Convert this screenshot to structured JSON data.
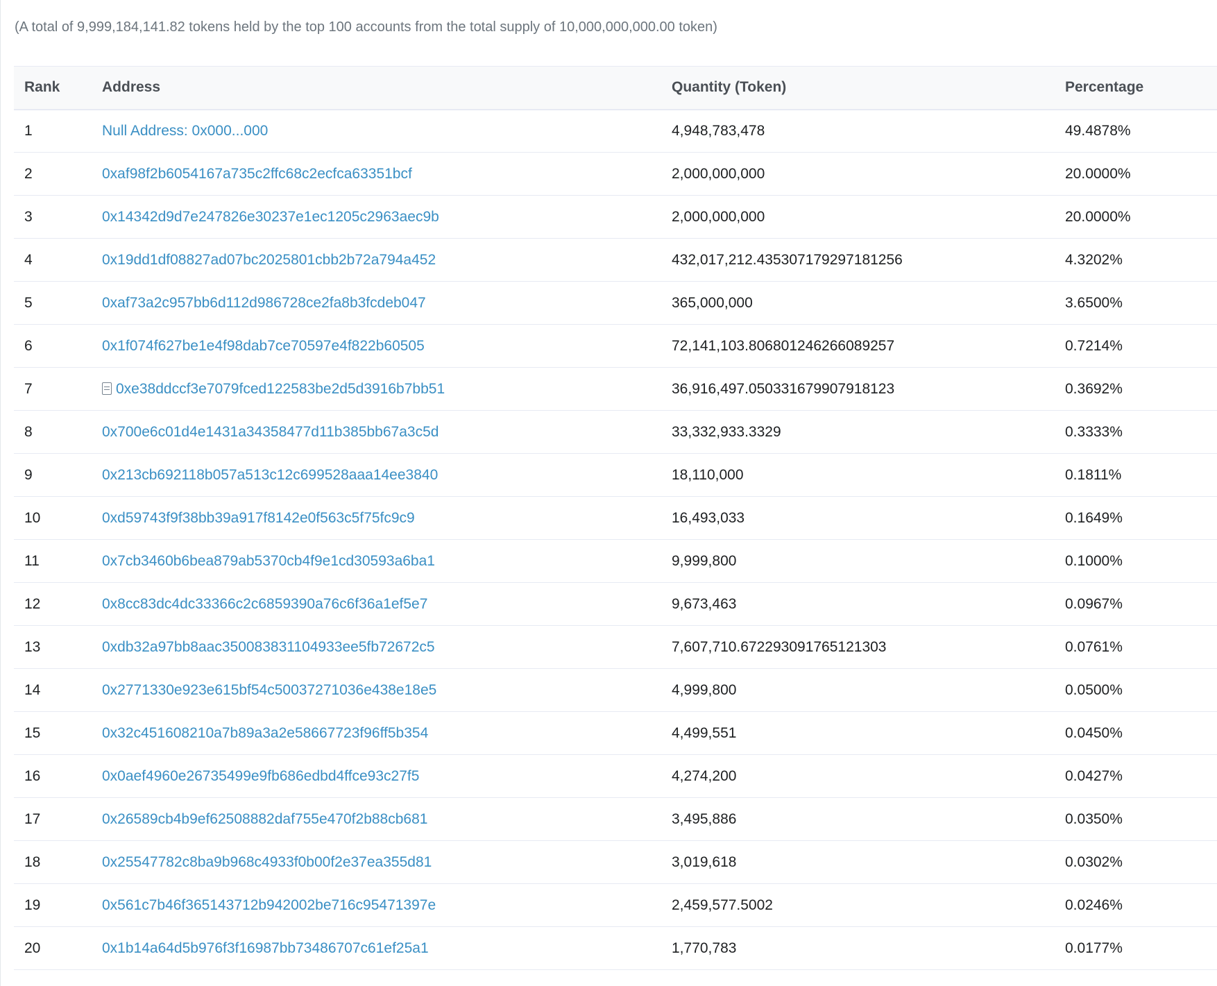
{
  "summary": "(A total of 9,999,184,141.82 tokens held by the top 100 accounts from the total supply of 10,000,000,000.00 token)",
  "table": {
    "headers": {
      "rank": "Rank",
      "address": "Address",
      "quantity": "Quantity (Token)",
      "percentage": "Percentage"
    },
    "rows": [
      {
        "rank": "1",
        "address": "Null Address: 0x000...000",
        "quantity": "4,948,783,478",
        "percentage": "49.4878%",
        "contract": false
      },
      {
        "rank": "2",
        "address": "0xaf98f2b6054167a735c2ffc68c2ecfca63351bcf",
        "quantity": "2,000,000,000",
        "percentage": "20.0000%",
        "contract": false
      },
      {
        "rank": "3",
        "address": "0x14342d9d7e247826e30237e1ec1205c2963aec9b",
        "quantity": "2,000,000,000",
        "percentage": "20.0000%",
        "contract": false
      },
      {
        "rank": "4",
        "address": "0x19dd1df08827ad07bc2025801cbb2b72a794a452",
        "quantity": "432,017,212.435307179297181256",
        "percentage": "4.3202%",
        "contract": false
      },
      {
        "rank": "5",
        "address": "0xaf73a2c957bb6d112d986728ce2fa8b3fcdeb047",
        "quantity": "365,000,000",
        "percentage": "3.6500%",
        "contract": false
      },
      {
        "rank": "6",
        "address": "0x1f074f627be1e4f98dab7ce70597e4f822b60505",
        "quantity": "72,141,103.806801246266089257",
        "percentage": "0.7214%",
        "contract": false
      },
      {
        "rank": "7",
        "address": "0xe38ddccf3e7079fced122583be2d5d3916b7bb51",
        "quantity": "36,916,497.050331679907918123",
        "percentage": "0.3692%",
        "contract": true
      },
      {
        "rank": "8",
        "address": "0x700e6c01d4e1431a34358477d11b385bb67a3c5d",
        "quantity": "33,332,933.3329",
        "percentage": "0.3333%",
        "contract": false
      },
      {
        "rank": "9",
        "address": "0x213cb692118b057a513c12c699528aaa14ee3840",
        "quantity": "18,110,000",
        "percentage": "0.1811%",
        "contract": false
      },
      {
        "rank": "10",
        "address": "0xd59743f9f38bb39a917f8142e0f563c5f75fc9c9",
        "quantity": "16,493,033",
        "percentage": "0.1649%",
        "contract": false
      },
      {
        "rank": "11",
        "address": "0x7cb3460b6bea879ab5370cb4f9e1cd30593a6ba1",
        "quantity": "9,999,800",
        "percentage": "0.1000%",
        "contract": false
      },
      {
        "rank": "12",
        "address": "0x8cc83dc4dc33366c2c6859390a76c6f36a1ef5e7",
        "quantity": "9,673,463",
        "percentage": "0.0967%",
        "contract": false
      },
      {
        "rank": "13",
        "address": "0xdb32a97bb8aac350083831104933ee5fb72672c5",
        "quantity": "7,607,710.672293091765121303",
        "percentage": "0.0761%",
        "contract": false
      },
      {
        "rank": "14",
        "address": "0x2771330e923e615bf54c50037271036e438e18e5",
        "quantity": "4,999,800",
        "percentage": "0.0500%",
        "contract": false
      },
      {
        "rank": "15",
        "address": "0x32c451608210a7b89a3a2e58667723f96ff5b354",
        "quantity": "4,499,551",
        "percentage": "0.0450%",
        "contract": false
      },
      {
        "rank": "16",
        "address": "0x0aef4960e26735499e9fb686edbd4ffce93c27f5",
        "quantity": "4,274,200",
        "percentage": "0.0427%",
        "contract": false
      },
      {
        "rank": "17",
        "address": "0x26589cb4b9ef62508882daf755e470f2b88cb681",
        "quantity": "3,495,886",
        "percentage": "0.0350%",
        "contract": false
      },
      {
        "rank": "18",
        "address": "0x25547782c8ba9b968c4933f0b00f2e37ea355d81",
        "quantity": "3,019,618",
        "percentage": "0.0302%",
        "contract": false
      },
      {
        "rank": "19",
        "address": "0x561c7b46f365143712b942002be716c95471397e",
        "quantity": "2,459,577.5002",
        "percentage": "0.0246%",
        "contract": false
      },
      {
        "rank": "20",
        "address": "0x1b14a64d5b976f3f16987bb73486707c61ef25a1",
        "quantity": "1,770,783",
        "percentage": "0.0177%",
        "contract": false
      }
    ]
  },
  "icons": {
    "contract": "contract-file-icon"
  },
  "colors": {
    "link": "#3a8fc4",
    "text": "#1e2022",
    "muted": "#6c757d",
    "header_bg": "#f8f9fa",
    "border": "#e7eaf3"
  }
}
